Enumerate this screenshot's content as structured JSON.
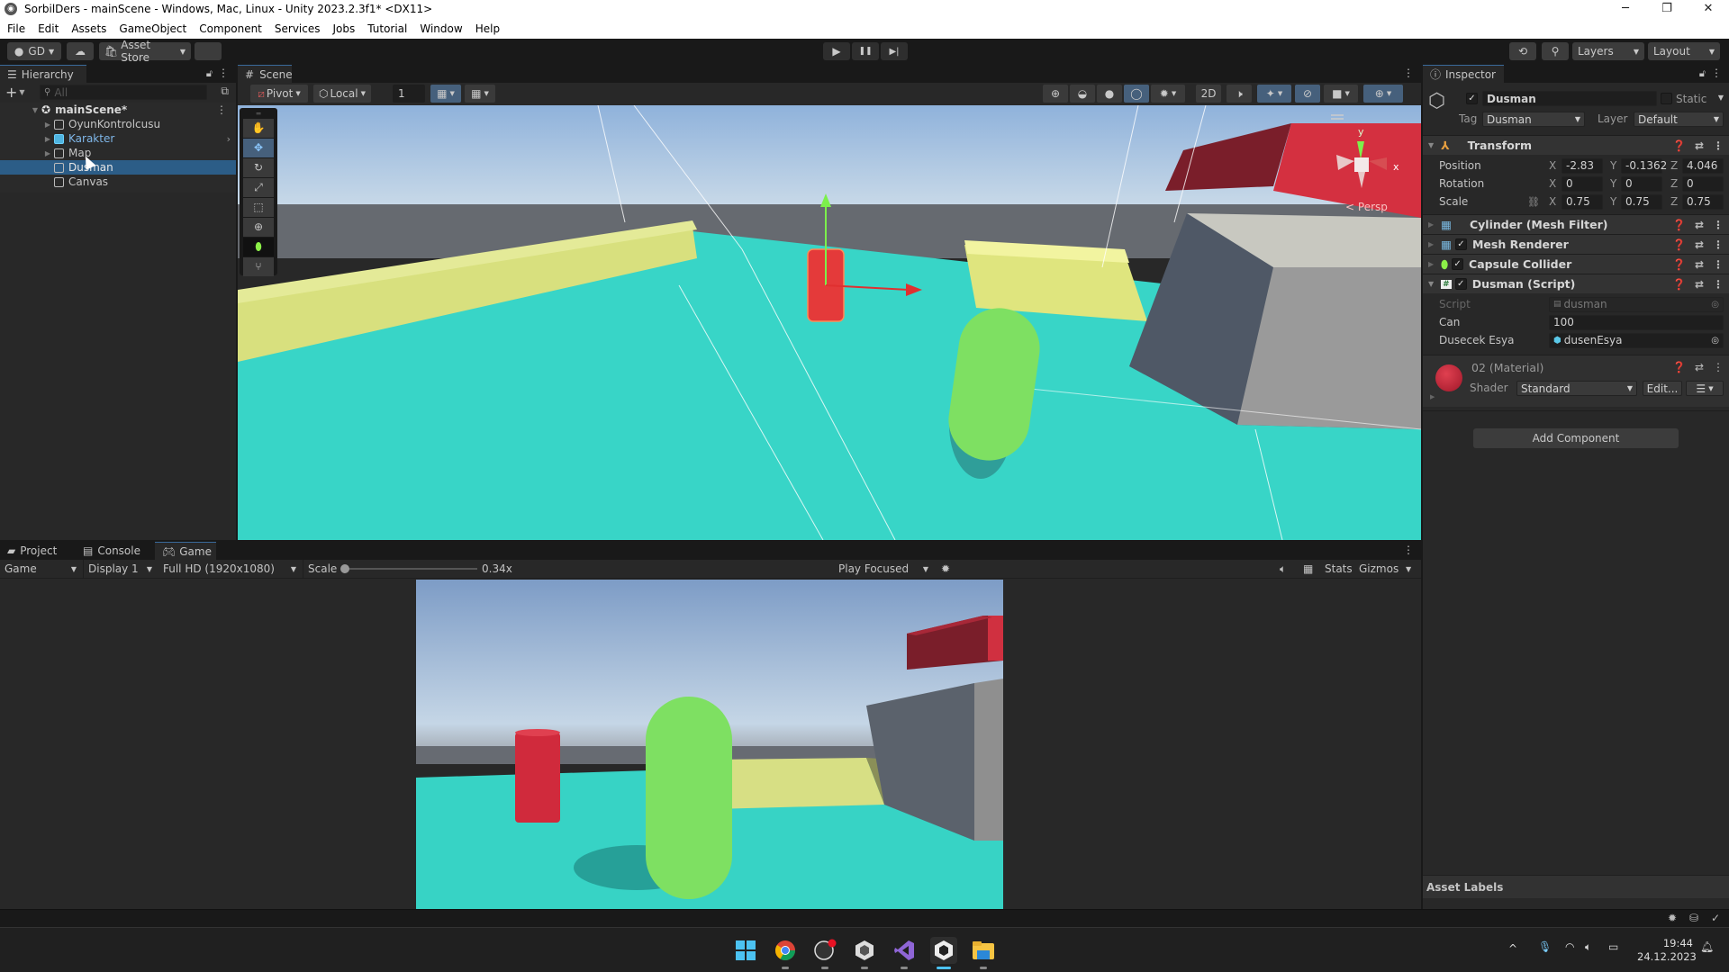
{
  "window": {
    "title": "SorbilDers - mainScene - Windows, Mac, Linux - Unity 2023.2.3f1* <DX11>",
    "controls": {
      "minimize": "─",
      "maximize": "❐",
      "close": "✕"
    }
  },
  "menu": [
    "File",
    "Edit",
    "Assets",
    "GameObject",
    "Component",
    "Services",
    "Jobs",
    "Tutorial",
    "Window",
    "Help"
  ],
  "toolbar": {
    "account_label": "GD",
    "asset_store_label": "Asset Store",
    "play_icons": {
      "play": "▶",
      "pause": "❚❚",
      "step": "▶|"
    },
    "layers_label": "Layers",
    "layout_label": "Layout"
  },
  "hierarchy": {
    "tab_label": "Hierarchy",
    "search_placeholder": "All",
    "scene_name": "mainScene*",
    "items": [
      {
        "label": "OyunKontrolcusu",
        "has_children": true,
        "selected": false,
        "prefab": false
      },
      {
        "label": "Karakter",
        "has_children": true,
        "selected": false,
        "prefab": true
      },
      {
        "label": "Map",
        "has_children": true,
        "selected": false,
        "prefab": false
      },
      {
        "label": "Dusman",
        "has_children": false,
        "selected": true,
        "prefab": false
      },
      {
        "label": "Canvas",
        "has_children": false,
        "selected": false,
        "prefab": false
      }
    ]
  },
  "scene": {
    "tab_label": "Scene",
    "pivot_label": "Pivot",
    "local_label": "Local",
    "grid_snap_value": "1",
    "mode_2d_label": "2D",
    "persp_label": "Persp",
    "gizmo_axes": {
      "y": "y",
      "x": "x"
    },
    "tools": [
      "hand",
      "move",
      "rotate",
      "scale",
      "rect",
      "transform",
      "collider-edit",
      "custom"
    ]
  },
  "game": {
    "tabs": [
      {
        "label": "Project",
        "active": false
      },
      {
        "label": "Console",
        "active": false
      },
      {
        "label": "Game",
        "active": true
      }
    ],
    "view_select": "Game",
    "display_select": "Display 1",
    "resolution_select": "Full HD (1920x1080)",
    "scale_label": "Scale",
    "scale_value": "0.34x",
    "scale_fraction": 0.0,
    "play_focused_label": "Play Focused",
    "stats_label": "Stats",
    "gizmos_label": "Gizmos"
  },
  "inspector": {
    "tab_label": "Inspector",
    "object_name": "Dusman",
    "active": true,
    "static_label": "Static",
    "tag_label": "Tag",
    "tag_value": "Dusman",
    "layer_label": "Layer",
    "layer_value": "Default",
    "transform": {
      "title": "Transform",
      "position": {
        "label": "Position",
        "x": "-2.83",
        "y": "-0.1362",
        "z": "4.046"
      },
      "rotation": {
        "label": "Rotation",
        "x": "0",
        "y": "0",
        "z": "0"
      },
      "scale": {
        "label": "Scale",
        "x": "0.75",
        "y": "0.75",
        "z": "0.75"
      }
    },
    "components": [
      {
        "title": "Cylinder (Mesh Filter)",
        "has_toggle": false
      },
      {
        "title": "Mesh Renderer",
        "has_toggle": true
      },
      {
        "title": "Capsule Collider",
        "has_toggle": true
      },
      {
        "title": "Dusman (Script)",
        "has_toggle": true
      }
    ],
    "script": {
      "script_label": "Script",
      "script_value": "dusman",
      "can_label": "Can",
      "can_value": "100",
      "dusecek_label": "Dusecek Esya",
      "dusecek_value": "dusenEsya"
    },
    "material": {
      "title": "02 (Material)",
      "shader_label": "Shader",
      "shader_value": "Standard",
      "edit_label": "Edit...",
      "color": "#c0283c"
    },
    "add_component_label": "Add Component",
    "asset_labels": "Asset Labels"
  },
  "taskbar": {
    "time": "19:44",
    "date": "24.12.2023",
    "apps": [
      "windows-start",
      "chrome",
      "obs",
      "unity-hub",
      "visual-studio",
      "unity",
      "file-explorer"
    ]
  },
  "colors": {
    "selection": "#2c5d87",
    "accent_blue": "#46607c",
    "sky_top": "#8aaed6",
    "ground": "#36d4c4",
    "enemy_red": "#d8283a",
    "player_green": "#7de060"
  }
}
